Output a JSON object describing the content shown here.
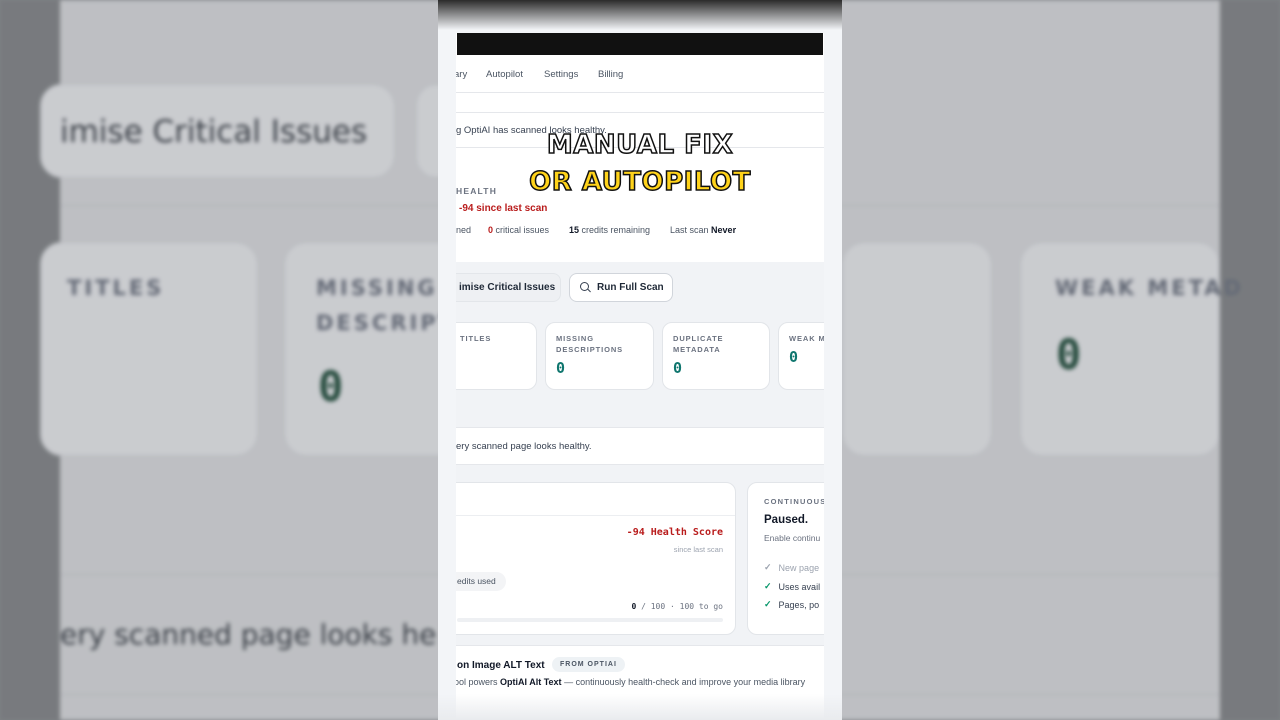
{
  "background": {
    "title": "imise Critical Issues",
    "labels": [
      "TITLES",
      "MISSING",
      "DESCRIPT",
      "WEAK METAD"
    ],
    "zero": "0",
    "footer": "ery scanned page looks he"
  },
  "nav": {
    "items": [
      "ary",
      "Autopilot",
      "Settings",
      "Billing"
    ]
  },
  "notice": "g OptiAI has scanned looks healthy.",
  "health": {
    "label": "HEALTH",
    "delta": "-94 since last scan",
    "stats": {
      "scanned_suffix": "ned",
      "critical_count": "0",
      "critical_label": "critical issues",
      "credits_count": "15",
      "credits_label": "credits remaining",
      "last_scan_label": "Last scan",
      "last_scan_value": "Never"
    }
  },
  "actions": {
    "optimise": "imise Critical Issues",
    "scan": "Run Full Scan"
  },
  "metrics": [
    {
      "label": "TITLES",
      "value": ""
    },
    {
      "label": "MISSING DESCRIPTIONS",
      "value": "0"
    },
    {
      "label": "DUPLICATE METADATA",
      "value": "0"
    },
    {
      "label": "WEAK METAD",
      "value": "0"
    }
  ],
  "healthy_msg": "ery scanned page looks healthy.",
  "score": {
    "value": "-94 Health Score",
    "sub": "since last scan",
    "credits": "edits used",
    "progress_current": "0",
    "progress_text": "/ 100 · 100 to go",
    "progress_fraction": 0
  },
  "continuous": {
    "label": "CONTINUOUS",
    "status": "Paused.",
    "sub": "Enable continu",
    "items": [
      "New page",
      "Uses avail",
      "Pages, po"
    ]
  },
  "alt": {
    "title": "on Image ALT Text",
    "badge": "FROM OPTIAI",
    "desc_prefix": "ool powers",
    "desc_bold": "OptiAI Alt Text",
    "desc_suffix": "— continuously health-check and improve your media library"
  },
  "captions": {
    "line1": "MANUAL FIX",
    "line2": "OR AUTOPILOT"
  },
  "colors": {
    "accent_red": "#b91c1c",
    "accent_green": "#0f766e",
    "caption_yellow": "#ffd31a"
  }
}
